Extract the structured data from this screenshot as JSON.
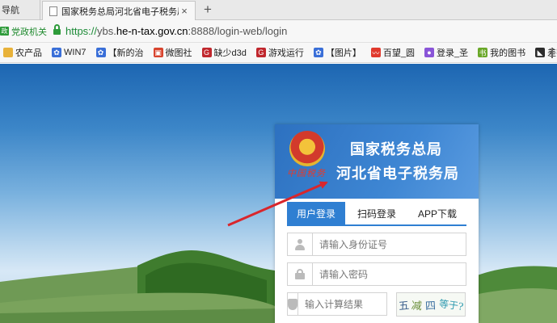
{
  "browser": {
    "prev_tab_label": "导航",
    "active_tab_title": "国家税务总局河北省电子税务局",
    "tab_close_glyph": "×",
    "new_tab_glyph": "+",
    "gov_badge": "党政机关",
    "url_scheme": "https://",
    "url_host_pre": "ybs.",
    "url_host": "he-n-tax.gov.cn",
    "url_rest": ":8888/login-web/login"
  },
  "bookmarks": [
    {
      "label": "农产品",
      "icon": "folder-icon",
      "color": "#e8b23a"
    },
    {
      "label": "WIN7",
      "icon": "paw-icon",
      "color": "#3a6fd8"
    },
    {
      "label": "【新的治",
      "icon": "paw-icon",
      "color": "#3a6fd8"
    },
    {
      "label": "微图社",
      "icon": "picture-icon",
      "color": "#d8442e"
    },
    {
      "label": "缺少d3d",
      "icon": "g-icon",
      "color": "#c0272d"
    },
    {
      "label": "游戏运行",
      "icon": "g-icon",
      "color": "#c0272d"
    },
    {
      "label": "【图片】",
      "icon": "paw-icon",
      "color": "#3a6fd8"
    },
    {
      "label": "百望_圆",
      "icon": "wave-icon",
      "color": "#e0392d"
    },
    {
      "label": "登录_圣",
      "icon": "circle-icon",
      "color": "#8a55d8"
    },
    {
      "label": "我的图书",
      "icon": "book-icon",
      "color": "#6aa829"
    },
    {
      "label": "差额征税",
      "icon": "bird-icon",
      "color": "#2c2c2c"
    }
  ],
  "login": {
    "header_line1": "国家税务总局",
    "header_line2": "河北省电子税务局",
    "emblem_text": "中国税务",
    "tabs": [
      {
        "label": "用户登录",
        "active": true
      },
      {
        "label": "扫码登录",
        "active": false
      },
      {
        "label": "APP下载",
        "active": false
      }
    ],
    "id_placeholder": "请输入身份证号",
    "password_placeholder": "请输入密码",
    "captcha_placeholder": "输入计算结果",
    "captcha_chars": [
      "五",
      "减",
      "四",
      "等于?"
    ]
  },
  "colors": {
    "accent": "#2f7fd2",
    "arrow": "#d9262c",
    "secure_green": "#1b8a36"
  }
}
